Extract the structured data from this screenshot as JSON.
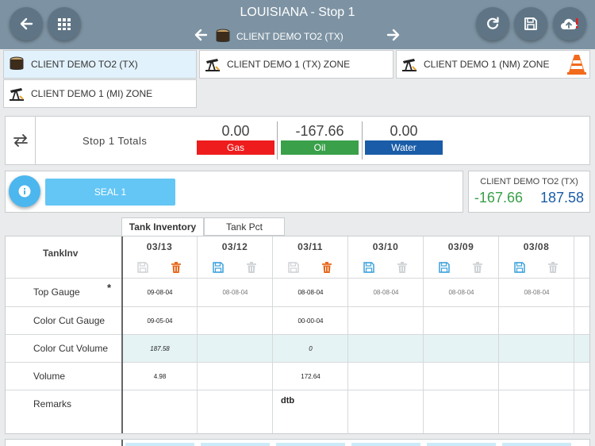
{
  "header": {
    "title": "LOUISIANA - Stop 1",
    "current_tank": "CLIENT DEMO TO2 (TX)"
  },
  "tank_tabs": [
    {
      "label": "CLIENT DEMO TO2 (TX)",
      "icon": "tank-icon",
      "active": true
    },
    {
      "label": "CLIENT DEMO 1 (TX) ZONE",
      "icon": "pumpjack-icon",
      "active": false
    },
    {
      "label": "CLIENT DEMO 1 (NM) ZONE",
      "icon": "pumpjack-icon",
      "active": false,
      "extra_icon": "traffic-cone-icon"
    },
    {
      "label": "CLIENT DEMO 1 (MI) ZONE",
      "icon": "pumpjack-icon",
      "active": false
    }
  ],
  "totals": {
    "label": "Stop 1 Totals",
    "gas": {
      "value": "0.00",
      "label": "Gas",
      "color": "#ee1c1c"
    },
    "oil": {
      "value": "-167.66",
      "label": "Oil",
      "color": "#3aa04a"
    },
    "water": {
      "value": "0.00",
      "label": "Water",
      "color": "#1a5ca8"
    }
  },
  "seal": {
    "button_label": "SEAL 1"
  },
  "client_summary": {
    "name": "CLIENT DEMO TO2 (TX)",
    "value_left": "-167.66",
    "value_right": "187.58",
    "color_left": "#3aa04a",
    "color_right": "#1a5ca8"
  },
  "grid_tabs": {
    "tank_inventory": "Tank Inventory",
    "tank_pct": "Tank Pct"
  },
  "grid": {
    "corner_label": "TankInv",
    "required_mark": "*",
    "dates": [
      "03/13",
      "03/12",
      "03/11",
      "03/10",
      "03/09",
      "03/08"
    ],
    "save_active": [
      false,
      true,
      false,
      true,
      true,
      true
    ],
    "delete_active": [
      true,
      false,
      true,
      false,
      false,
      false
    ],
    "rows": [
      {
        "label": "Top Gauge",
        "values": [
          "09-08-04",
          "08-08-04",
          "08-08-04",
          "08-08-04",
          "08-08-04",
          "08-08-04"
        ],
        "highlight": false
      },
      {
        "label": "Color Cut Gauge",
        "values": [
          "09-05-04",
          "",
          "00-00-04",
          "",
          "",
          ""
        ],
        "highlight": false
      },
      {
        "label": "Color Cut Volume",
        "values": [
          "187.58",
          "",
          "0",
          "",
          "",
          ""
        ],
        "highlight": true
      },
      {
        "label": "Volume",
        "values": [
          "4.98",
          "",
          "172.64",
          "",
          "",
          ""
        ],
        "highlight": false
      },
      {
        "label": "Remarks",
        "values": [
          "",
          "",
          "dtb",
          "",
          "",
          ""
        ],
        "highlight": false
      }
    ]
  }
}
